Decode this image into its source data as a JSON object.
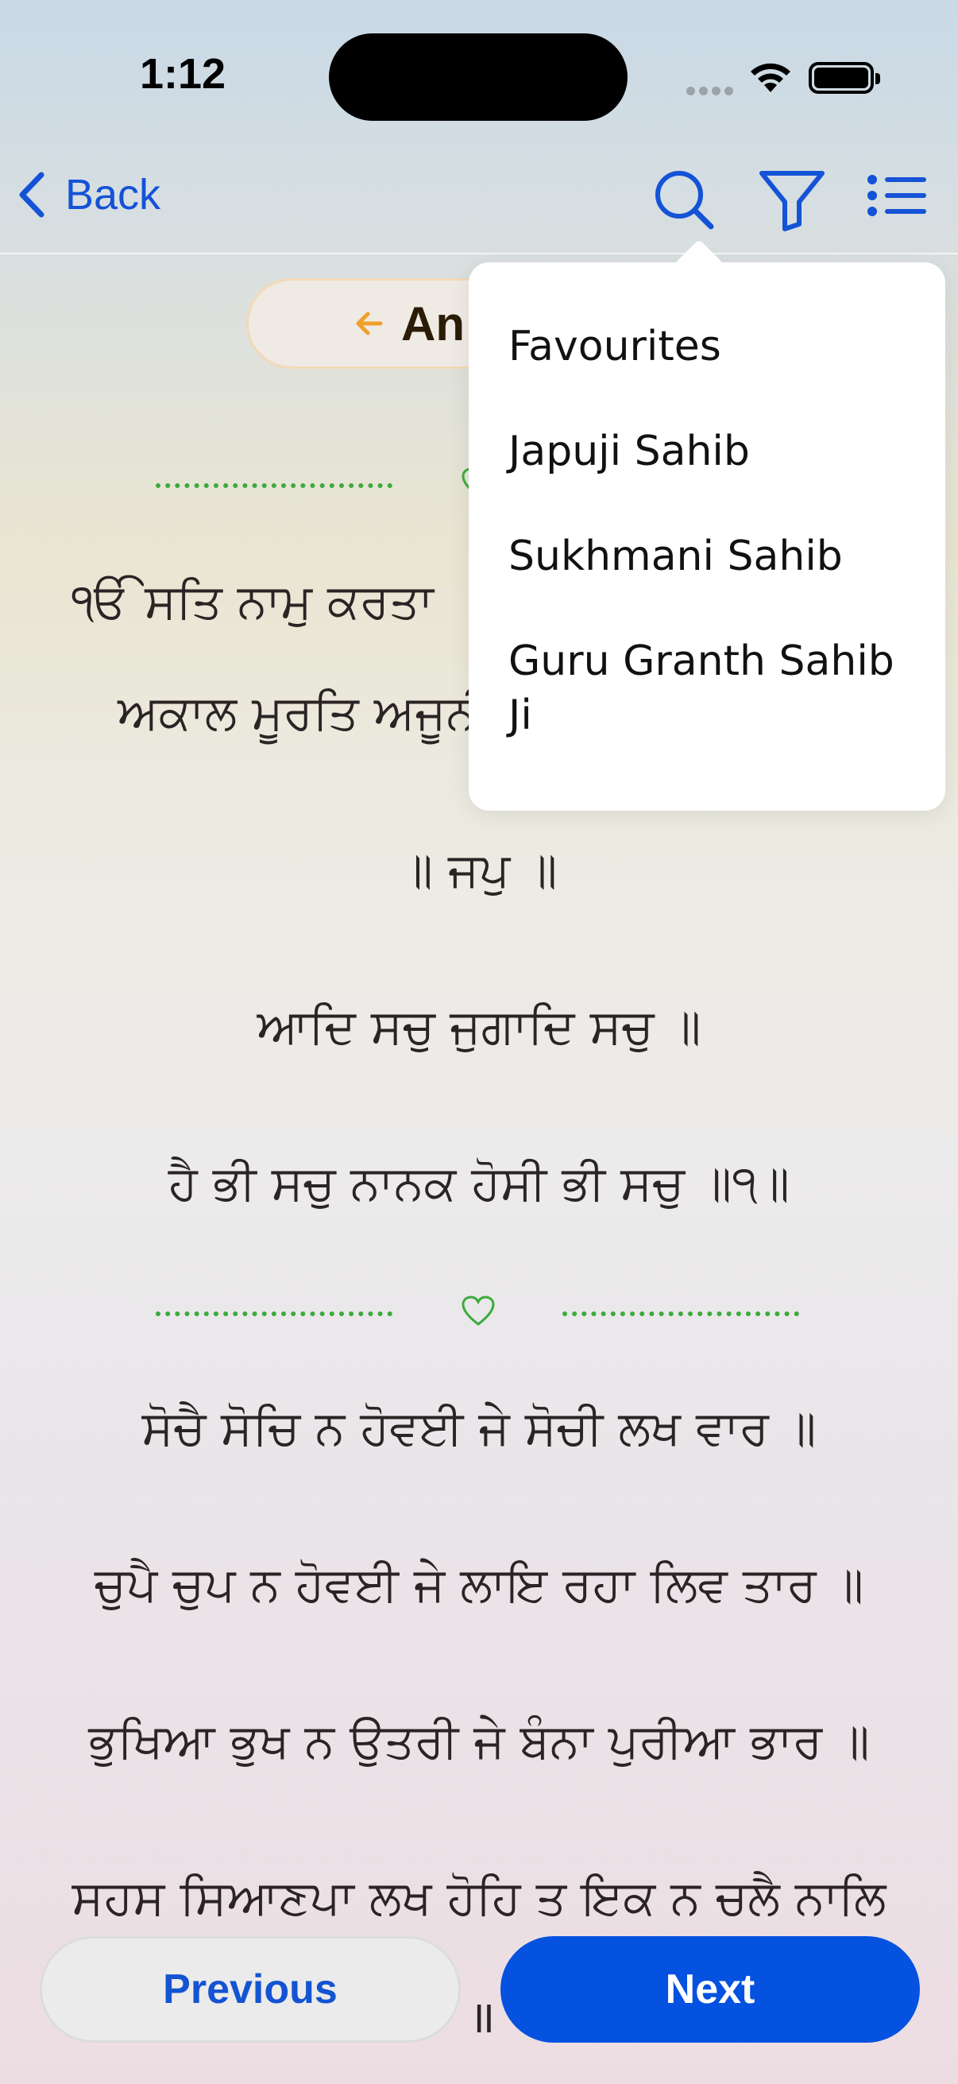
{
  "status_bar": {
    "time": "1:12"
  },
  "nav": {
    "back_label": "Back"
  },
  "chip": {
    "label": "An"
  },
  "verses": [
    "ੴ ਸਤਿ ਨਾਮੁ ਕਰਤਾ",
    "ਅਕਾਲ ਮੂਰਤਿ ਅਜੂਨੀ",
    "॥ ਜਪੁ ॥",
    "ਆਦਿ ਸਚੁ ਜੁਗਾਦਿ ਸਚੁ ॥",
    "ਹੈ ਭੀ ਸਚੁ ਨਾਨਕ ਹੋਸੀ ਭੀ ਸਚੁ ॥੧॥",
    "ਸੋਚੈ ਸੋਚਿ ਨ ਹੋਵਈ ਜੇ ਸੋਚੀ ਲਖ ਵਾਰ ॥",
    "ਚੁਪੈ ਚੁਪ ਨ ਹੋਵਈ ਜੇ ਲਾਇ ਰਹਾ ਲਿਵ ਤਾਰ ॥",
    "ਭੁਖਿਆ ਭੁਖ ਨ ਉਤਰੀ ਜੇ ਬੰਨਾ ਪੁਰੀਆ ਭਾਰ ॥",
    "ਸਹਸ ਸਿਆਣਪਾ ਲਖ ਹੋਹਿ ਤ ਇਕ ਨ ਚਲੈ ਨਾਲਿ",
    "॥"
  ],
  "menu": {
    "items": [
      "Favourites",
      "Japuji Sahib",
      "Sukhmani Sahib",
      "Guru Granth Sahib Ji"
    ]
  },
  "buttons": {
    "previous": "Previous",
    "next": "Next"
  },
  "colors": {
    "accent": "#0552e0",
    "link": "#1452d6",
    "divider": "#3caa3c",
    "chip_arrow": "#f0a02a"
  },
  "icons": [
    "chevron-left-icon",
    "search-icon",
    "filter-icon",
    "list-icon",
    "arrow-left-icon",
    "heart-icon",
    "wifi-icon",
    "battery-icon"
  ]
}
